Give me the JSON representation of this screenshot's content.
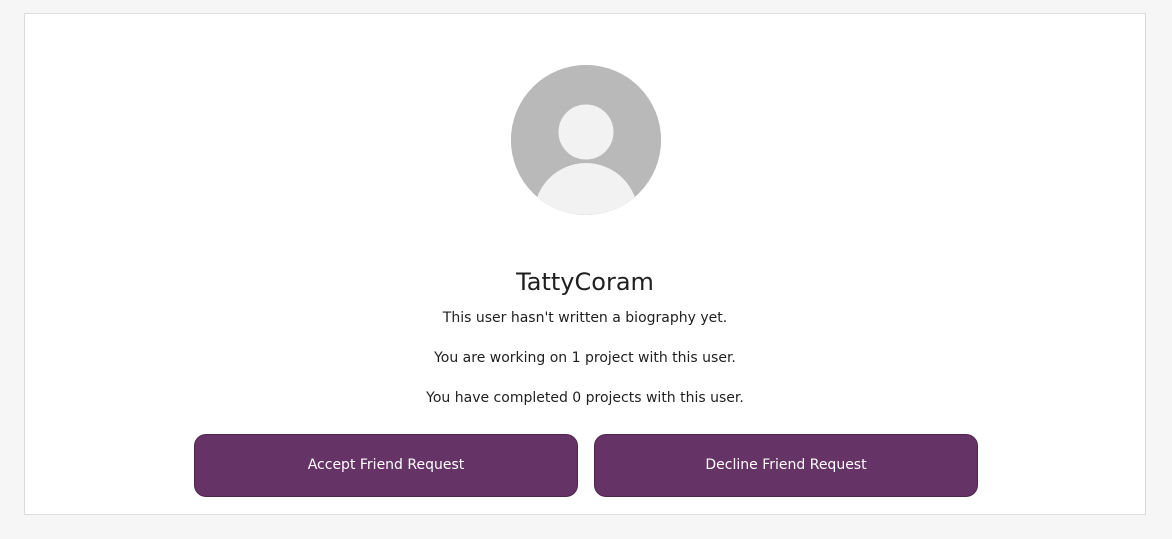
{
  "profile": {
    "username": "TattyCoram",
    "biography": "This user hasn't written a biography yet.",
    "working_text": "You are working on 1 project with this user.",
    "completed_text": "You have completed 0 projects with this user.",
    "avatar_icon": "default-user-avatar-icon"
  },
  "actions": {
    "accept_label": "Accept Friend Request",
    "decline_label": "Decline Friend Request"
  },
  "colors": {
    "button_bg": "#663366",
    "page_bg": "#f6f6f6",
    "avatar_bg": "#b9b9b9",
    "avatar_fg": "#f2f2f2"
  }
}
